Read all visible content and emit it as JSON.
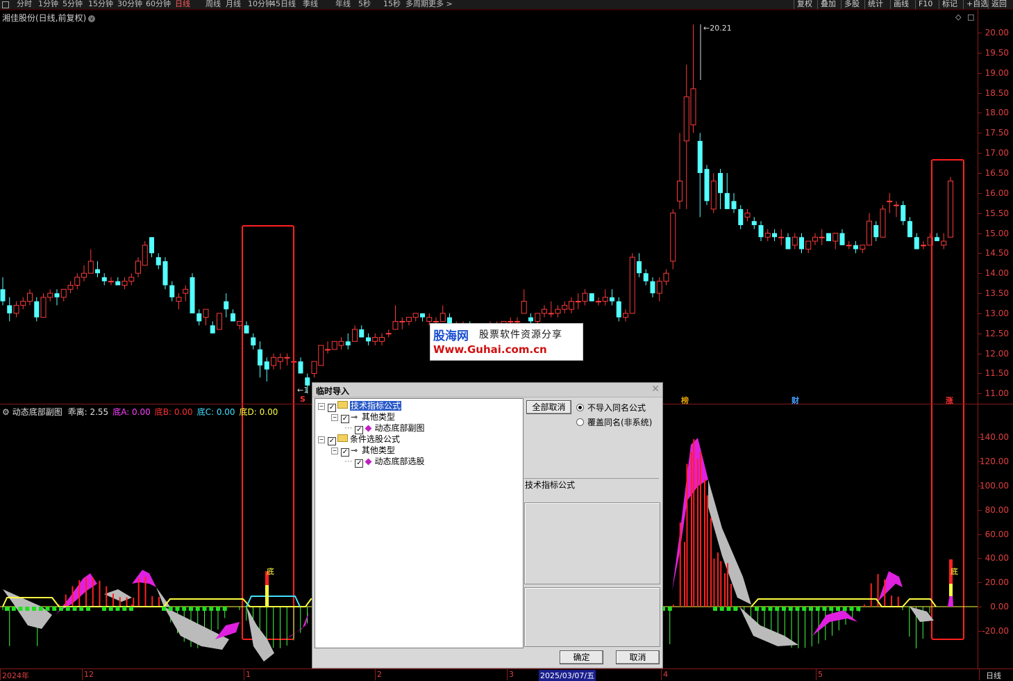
{
  "toolbar": {
    "items": [
      "分时",
      "1分钟",
      "5分钟",
      "15分钟",
      "30分钟",
      "60分钟",
      "日线",
      "周线",
      "月线",
      "10分钟",
      "45日线",
      "季线",
      "年线",
      "5秒",
      "15秒",
      "多周期",
      "更多 >"
    ],
    "active": "日线",
    "right": [
      "复权",
      "叠加",
      "多股",
      "统计",
      "画线",
      "F10",
      "标记",
      "+自选",
      "返回"
    ]
  },
  "stock": {
    "title": "湘佳股份(日线,前复权)"
  },
  "price_axis": [
    "20.00",
    "19.50",
    "19.00",
    "18.50",
    "18.00",
    "17.50",
    "17.00",
    "16.50",
    "16.00",
    "15.50",
    "15.00",
    "14.50",
    "14.00",
    "13.50",
    "13.00",
    "12.50",
    "12.00",
    "11.50",
    "11.00"
  ],
  "high_label": "20.21",
  "low_label": "1",
  "indicator": {
    "name": "动态底部副图",
    "items": [
      {
        "label": "乖离:",
        "value": "2.55",
        "color": "#e0e0e0"
      },
      {
        "label": "底A:",
        "value": "0.00",
        "color": "#ff40ff"
      },
      {
        "label": "底B:",
        "value": "0.00",
        "color": "#ff3030"
      },
      {
        "label": "底C:",
        "value": "0.00",
        "color": "#40e0ff"
      },
      {
        "label": "底D:",
        "value": "0.00",
        "color": "#ffff40"
      }
    ],
    "axis": [
      "140.00",
      "120.00",
      "100.00",
      "80.00",
      "60.00",
      "40.00",
      "20.00",
      "0.00",
      "-20.00"
    ],
    "signal_label": "底"
  },
  "event_marks": {
    "sell": "S",
    "rank": "榜",
    "finance": "财",
    "rise": "涨"
  },
  "dates": {
    "labels": [
      "2024年",
      "12",
      "1",
      "2",
      "3",
      "4",
      "5"
    ],
    "cursor": "2025/03/07/五",
    "period": "日线"
  },
  "watermark": {
    "brand": "股海网",
    "slogan": "股票软件资源分享",
    "url": "Www.Guhai.com.cn"
  },
  "dialog": {
    "title": "临时导入",
    "tree": [
      {
        "label": "技术指标公式",
        "level": 0,
        "selected": true
      },
      {
        "label": "其他类型",
        "level": 1
      },
      {
        "label": "动态底部副图",
        "level": 2
      },
      {
        "label": "条件选股公式",
        "level": 0
      },
      {
        "label": "其他类型",
        "level": 1
      },
      {
        "label": "动态底部选股",
        "level": 2
      }
    ],
    "cancel_all": "全部取消",
    "options": [
      "不导入同名公式",
      "覆盖同名(非系统)"
    ],
    "selected_option": 0,
    "info_label": "技术指标公式",
    "ok": "确定",
    "cancel": "取消"
  },
  "chart_data": {
    "type": "candlestick",
    "ylim": [
      10.8,
      20.3
    ],
    "candles": [
      [
        13.6,
        13.9,
        13.2,
        13.3
      ],
      [
        13.2,
        13.4,
        12.8,
        13.0
      ],
      [
        13.0,
        13.3,
        12.9,
        13.2
      ],
      [
        13.2,
        13.4,
        13.1,
        13.3
      ],
      [
        13.3,
        13.6,
        13.2,
        13.5
      ],
      [
        13.3,
        13.4,
        12.8,
        12.9
      ],
      [
        12.9,
        13.5,
        12.9,
        13.4
      ],
      [
        13.4,
        13.6,
        13.3,
        13.5
      ],
      [
        13.5,
        13.6,
        13.2,
        13.4
      ],
      [
        13.4,
        13.6,
        13.3,
        13.6
      ],
      [
        13.6,
        13.8,
        13.5,
        13.7
      ],
      [
        13.7,
        14.0,
        13.6,
        13.9
      ],
      [
        13.9,
        14.2,
        13.8,
        14.0
      ],
      [
        14.0,
        14.6,
        14.0,
        14.3
      ],
      [
        14.1,
        14.3,
        13.9,
        14.0
      ],
      [
        13.9,
        14.0,
        13.7,
        13.8
      ],
      [
        13.8,
        13.9,
        13.7,
        13.8
      ],
      [
        13.8,
        13.9,
        13.7,
        13.7
      ],
      [
        13.7,
        13.9,
        13.6,
        13.8
      ],
      [
        13.8,
        14.0,
        13.7,
        13.9
      ],
      [
        14.0,
        14.4,
        13.9,
        14.3
      ],
      [
        14.2,
        14.8,
        14.2,
        14.7
      ],
      [
        14.9,
        14.9,
        14.4,
        14.5
      ],
      [
        14.4,
        14.5,
        14.1,
        14.2
      ],
      [
        14.3,
        14.4,
        13.6,
        13.7
      ],
      [
        13.7,
        13.8,
        13.3,
        13.4
      ],
      [
        13.3,
        13.5,
        13.1,
        13.4
      ],
      [
        13.5,
        13.7,
        13.3,
        13.6
      ],
      [
        13.9,
        14.0,
        13.0,
        13.0
      ],
      [
        13.0,
        13.1,
        12.7,
        12.8
      ],
      [
        12.9,
        13.1,
        12.7,
        13.1
      ],
      [
        12.7,
        12.8,
        12.5,
        12.5
      ],
      [
        12.6,
        13.0,
        12.6,
        13.0
      ],
      [
        13.3,
        13.5,
        12.9,
        13.1
      ],
      [
        13.0,
        13.1,
        12.8,
        12.8
      ],
      [
        12.7,
        12.8,
        12.6,
        12.8
      ],
      [
        12.7,
        12.8,
        12.5,
        12.5
      ],
      [
        12.4,
        12.5,
        12.1,
        12.2
      ],
      [
        12.1,
        12.3,
        11.4,
        11.7
      ],
      [
        11.8,
        11.9,
        11.3,
        11.6
      ],
      [
        11.7,
        12.0,
        11.6,
        11.9
      ],
      [
        11.8,
        12.0,
        11.6,
        11.9
      ],
      [
        11.9,
        12.0,
        11.7,
        11.9
      ],
      [
        11.8,
        11.9,
        11.7,
        11.8
      ],
      [
        11.8,
        11.9,
        11.5,
        11.5
      ],
      [
        11.4,
        11.5,
        11.0,
        11.2
      ],
      [
        11.5,
        11.8,
        11.4,
        11.8
      ],
      [
        11.7,
        12.2,
        11.7,
        12.2
      ],
      [
        12.1,
        12.3,
        12.0,
        12.1
      ],
      [
        12.1,
        12.3,
        12.1,
        12.3
      ],
      [
        12.2,
        12.4,
        12.1,
        12.3
      ],
      [
        12.3,
        12.5,
        12.1,
        12.2
      ],
      [
        12.3,
        12.7,
        12.3,
        12.6
      ],
      [
        12.6,
        12.7,
        12.4,
        12.4
      ],
      [
        12.4,
        12.5,
        12.2,
        12.3
      ],
      [
        12.3,
        12.5,
        12.2,
        12.4
      ],
      [
        12.3,
        12.5,
        12.2,
        12.4
      ],
      [
        12.5,
        12.6,
        12.4,
        12.5
      ],
      [
        12.6,
        13.2,
        12.6,
        12.8
      ],
      [
        12.8,
        12.9,
        12.6,
        12.8
      ],
      [
        12.8,
        12.9,
        12.7,
        12.9
      ],
      [
        12.9,
        13.0,
        12.8,
        13.0
      ],
      [
        13.0,
        13.0,
        12.8,
        12.9
      ],
      [
        12.8,
        13.0,
        12.7,
        12.9
      ],
      [
        12.8,
        12.9,
        12.7,
        12.8
      ],
      [
        12.8,
        13.2,
        12.8,
        13.0
      ],
      [
        12.9,
        13.0,
        12.6,
        12.7
      ],
      [
        12.7,
        12.8,
        12.5,
        12.7
      ],
      [
        12.7,
        12.8,
        12.6,
        12.7
      ],
      [
        12.7,
        12.8,
        12.5,
        12.6
      ],
      [
        12.6,
        12.7,
        12.5,
        12.6
      ],
      [
        12.6,
        12.7,
        12.5,
        12.6
      ],
      [
        12.6,
        12.8,
        12.6,
        12.7
      ],
      [
        12.7,
        12.8,
        12.6,
        12.7
      ],
      [
        12.7,
        12.8,
        12.6,
        12.8
      ],
      [
        12.8,
        12.9,
        12.6,
        12.8
      ],
      [
        12.8,
        12.9,
        12.7,
        12.8
      ],
      [
        13.0,
        13.6,
        13.0,
        13.3
      ],
      [
        12.9,
        13.0,
        12.7,
        12.8
      ],
      [
        12.8,
        13.0,
        12.7,
        13.0
      ],
      [
        13.0,
        13.2,
        12.9,
        13.1
      ],
      [
        13.0,
        13.3,
        12.9,
        13.0
      ],
      [
        13.0,
        13.2,
        12.9,
        13.1
      ],
      [
        13.1,
        13.3,
        13.0,
        13.2
      ],
      [
        13.1,
        13.4,
        13.0,
        13.3
      ],
      [
        13.3,
        13.5,
        13.1,
        13.3
      ],
      [
        13.3,
        13.6,
        13.2,
        13.5
      ],
      [
        13.5,
        13.5,
        13.3,
        13.3
      ],
      [
        13.3,
        13.4,
        13.2,
        13.3
      ],
      [
        13.3,
        13.6,
        13.2,
        13.4
      ],
      [
        13.4,
        13.6,
        13.2,
        13.3
      ],
      [
        13.3,
        13.4,
        12.8,
        12.9
      ],
      [
        12.9,
        13.1,
        12.8,
        13.0
      ],
      [
        13.0,
        14.5,
        13.0,
        14.4
      ],
      [
        14.3,
        14.5,
        13.9,
        14.0
      ],
      [
        14.0,
        14.1,
        13.7,
        13.8
      ],
      [
        13.8,
        13.9,
        13.4,
        13.5
      ],
      [
        13.5,
        13.9,
        13.3,
        13.8
      ],
      [
        13.8,
        14.1,
        13.7,
        14.0
      ],
      [
        14.3,
        15.6,
        14.1,
        15.5
      ],
      [
        15.8,
        17.5,
        15.6,
        16.3
      ],
      [
        17.3,
        19.2,
        15.6,
        18.4
      ],
      [
        17.7,
        20.2,
        17.5,
        18.6
      ],
      [
        17.3,
        17.5,
        15.4,
        16.5
      ],
      [
        16.6,
        16.7,
        15.7,
        15.8
      ],
      [
        15.6,
        16.5,
        15.5,
        16.3
      ],
      [
        16.5,
        16.6,
        15.6,
        16.0
      ],
      [
        16.0,
        16.5,
        15.6,
        15.6
      ],
      [
        15.8,
        16.0,
        15.5,
        15.6
      ],
      [
        15.6,
        15.7,
        15.1,
        15.2
      ],
      [
        15.4,
        15.6,
        15.3,
        15.5
      ],
      [
        15.3,
        15.4,
        15.1,
        15.2
      ],
      [
        15.2,
        15.3,
        14.8,
        14.9
      ],
      [
        14.9,
        15.1,
        14.8,
        15.0
      ],
      [
        15.0,
        15.1,
        14.8,
        14.9
      ],
      [
        14.9,
        15.1,
        14.7,
        14.9
      ],
      [
        14.9,
        15.0,
        14.6,
        14.6
      ],
      [
        14.7,
        15.0,
        14.6,
        14.9
      ],
      [
        14.9,
        15.0,
        14.5,
        14.6
      ],
      [
        14.6,
        14.8,
        14.5,
        14.8
      ],
      [
        14.8,
        15.0,
        14.7,
        14.9
      ],
      [
        14.9,
        15.1,
        14.7,
        14.9
      ],
      [
        15.0,
        15.0,
        14.8,
        14.8
      ],
      [
        14.8,
        15.0,
        14.6,
        15.0
      ],
      [
        15.0,
        15.1,
        14.7,
        14.7
      ],
      [
        14.7,
        14.8,
        14.6,
        14.7
      ],
      [
        14.7,
        14.8,
        14.5,
        14.6
      ],
      [
        14.6,
        14.7,
        14.5,
        14.7
      ],
      [
        14.7,
        15.5,
        14.7,
        15.3
      ],
      [
        15.2,
        15.3,
        14.8,
        14.9
      ],
      [
        14.9,
        15.7,
        14.9,
        15.6
      ],
      [
        15.8,
        16.0,
        15.5,
        15.8
      ],
      [
        15.7,
        15.8,
        15.4,
        15.7
      ],
      [
        15.7,
        15.8,
        15.2,
        15.3
      ],
      [
        15.3,
        15.4,
        14.9,
        14.9
      ],
      [
        14.9,
        15.0,
        14.6,
        14.6
      ],
      [
        14.7,
        14.8,
        14.6,
        14.7
      ],
      [
        14.7,
        15.0,
        14.7,
        14.9
      ],
      [
        14.9,
        15.0,
        14.8,
        14.8
      ],
      [
        14.7,
        15.0,
        14.6,
        14.8
      ],
      [
        14.9,
        16.4,
        14.9,
        16.3
      ]
    ]
  }
}
